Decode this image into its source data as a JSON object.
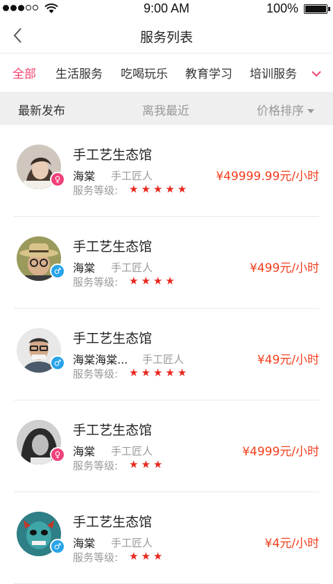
{
  "status_bar": {
    "time": "9:00 AM",
    "battery": "100%"
  },
  "nav": {
    "title": "服务列表"
  },
  "tabs": [
    {
      "label": "全部",
      "active": true
    },
    {
      "label": "生活服务"
    },
    {
      "label": "吃喝玩乐"
    },
    {
      "label": "教育学习"
    },
    {
      "label": "培训服务"
    }
  ],
  "sort": {
    "latest": "最新发布",
    "nearest": "离我最近",
    "price": "价格排序"
  },
  "items": [
    {
      "name": "手工艺生态馆",
      "owner": "海棠",
      "role": "手工匠人",
      "level_label": "服务等级:",
      "stars": "★★★★★",
      "price": "¥49999.99元/小时",
      "gender": "female",
      "gender_symbol": "♀"
    },
    {
      "name": "手工艺生态馆",
      "owner": "海棠",
      "role": "手工匠人",
      "level_label": "服务等级:",
      "stars": "★★★★",
      "price": "¥499元/小时",
      "gender": "male",
      "gender_symbol": "♂"
    },
    {
      "name": "手工艺生态馆",
      "owner": "海棠海棠...",
      "role": "手工匠人",
      "level_label": "服务等级:",
      "stars": "★★★★★",
      "price": "¥49元/小时",
      "gender": "male",
      "gender_symbol": "♂"
    },
    {
      "name": "手工艺生态馆",
      "owner": "海棠",
      "role": "手工匠人",
      "level_label": "服务等级:",
      "stars": "★★★",
      "price": "¥4999元/小时",
      "gender": "female",
      "gender_symbol": "♀"
    },
    {
      "name": "手工艺生态馆",
      "owner": "海棠",
      "role": "手工匠人",
      "level_label": "服务等级:",
      "stars": "★★★",
      "price": "¥4元/小时",
      "gender": "male",
      "gender_symbol": "♂"
    }
  ],
  "colors": {
    "accent": "#f0426e",
    "price": "#f23d1c",
    "star": "#e8261c",
    "male": "#27a3ea",
    "female": "#f0427a"
  }
}
